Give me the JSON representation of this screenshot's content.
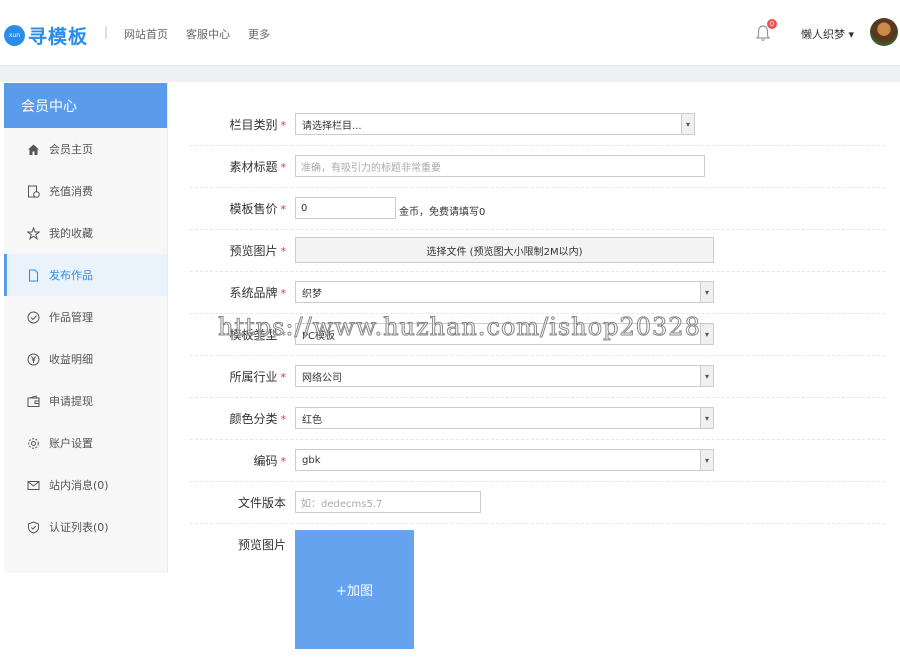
{
  "header": {
    "logo_badge": "xun",
    "logo_text": "寻模板",
    "separator": "|",
    "nav": [
      "网站首页",
      "客服中心",
      "更多"
    ],
    "notification_count": "0",
    "username": "懒人织梦 ▾"
  },
  "sidebar": {
    "title": "会员中心",
    "items": [
      {
        "label": "会员主页",
        "icon": "home-icon"
      },
      {
        "label": "充值消费",
        "icon": "recharge-icon"
      },
      {
        "label": "我的收藏",
        "icon": "star-icon"
      },
      {
        "label": "发布作品",
        "icon": "file-icon",
        "active": true
      },
      {
        "label": "作品管理",
        "icon": "check-circle-icon"
      },
      {
        "label": "收益明细",
        "icon": "yen-icon"
      },
      {
        "label": "申请提现",
        "icon": "wallet-icon"
      },
      {
        "label": "账户设置",
        "icon": "gear-icon"
      },
      {
        "label": "站内消息(0)",
        "icon": "mail-icon"
      },
      {
        "label": "认证列表(0)",
        "icon": "shield-icon"
      }
    ]
  },
  "form": {
    "category": {
      "label": "栏目类别",
      "value": "请选择栏目..."
    },
    "title": {
      "label": "素材标题",
      "placeholder": "准确，有吸引力的标题非常重要"
    },
    "price": {
      "label": "模板售价",
      "value": "0",
      "hint": "金币，免费请填写0"
    },
    "preview": {
      "label": "预览图片",
      "button": "选择文件 (预览图大小限制2M以内)"
    },
    "brand": {
      "label": "系统品牌",
      "value": "织梦"
    },
    "type": {
      "label": "模板类型",
      "value": "PC模板"
    },
    "industry": {
      "label": "所属行业",
      "value": "网络公司"
    },
    "color": {
      "label": "颜色分类",
      "value": "红色"
    },
    "encoding": {
      "label": "编码",
      "value": "gbk"
    },
    "version": {
      "label": "文件版本",
      "placeholder": "如：dedecms5.7"
    },
    "gallery": {
      "label": "预览图片",
      "button": "+加图"
    },
    "required_mark": "*"
  },
  "watermark": "https://www.huzhan.com/ishop20328",
  "colors": {
    "accent": "#5b9bec",
    "brand": "#2a8ee8",
    "required": "#e33333"
  }
}
